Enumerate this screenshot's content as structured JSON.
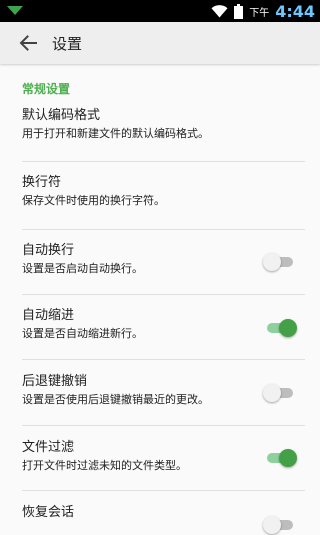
{
  "status_bar": {
    "ampm": "下午",
    "time": "4:44"
  },
  "toolbar": {
    "title": "设置"
  },
  "section": {
    "header": "常规设置",
    "accent_color": "#4caf50"
  },
  "preferences": [
    {
      "title": "默认编码格式",
      "summary": "用于打开和新建文件的默认编码格式。",
      "type": "text"
    },
    {
      "title": "换行符",
      "summary": "保存文件时使用的换行字符。",
      "type": "text"
    },
    {
      "title": "自动换行",
      "summary": "设置是否启动自动换行。",
      "type": "switch",
      "checked": false
    },
    {
      "title": "自动缩进",
      "summary": "设置是否自动缩进新行。",
      "type": "switch",
      "checked": true
    },
    {
      "title": "后退键撤销",
      "summary": "设置是否使用后退键撤销最近的更改。",
      "type": "switch",
      "checked": false
    },
    {
      "title": "文件过滤",
      "summary": "打开文件时过滤未知的文件类型。",
      "type": "switch",
      "checked": true
    },
    {
      "title": "恢复会话",
      "summary": "",
      "type": "switch",
      "checked": false
    }
  ]
}
